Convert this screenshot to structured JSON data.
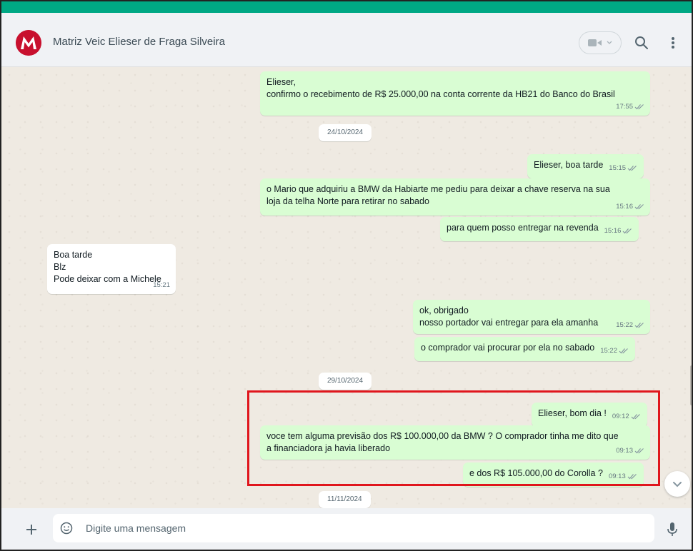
{
  "header": {
    "contact_name": "Matriz Veic Elieser de Fraga Silveira",
    "icons": {
      "avatar": "company-logo",
      "video": "video-call-icon",
      "search": "search-icon",
      "menu": "more-vertical-icon"
    }
  },
  "messages": [
    {
      "type": "out",
      "text": "Elieser,\nconfirmo o recebimento de R$ 25.000,00 na conta corrente da HB21 do Banco do Brasil",
      "time": "17:55"
    },
    {
      "type": "date",
      "text": "24/10/2024"
    },
    {
      "type": "out",
      "text": "Elieser, boa tarde",
      "time": "15:15"
    },
    {
      "type": "out",
      "text": "o Mario que adquiriu a BMW da Habiarte me pediu para deixar a chave reserva na sua\nloja da telha Norte para retirar no sabado",
      "time": "15:16"
    },
    {
      "type": "out",
      "text": "para quem posso entregar na revenda",
      "time": "15:16"
    },
    {
      "type": "in",
      "text": "Boa tarde\nBlz\nPode deixar com a Michele",
      "time": "15:21"
    },
    {
      "type": "out",
      "text": "ok, obrigado\nnosso portador vai entregar para ela amanha",
      "time": "15:22"
    },
    {
      "type": "out",
      "text": "o comprador vai procurar por ela no sabado",
      "time": "15:22"
    },
    {
      "type": "date",
      "text": "29/10/2024"
    },
    {
      "type": "out",
      "text": "Elieser, bom dia !",
      "time": "09:12"
    },
    {
      "type": "out",
      "text": "voce tem alguma previsão dos R$ 100.000,00 da BMW ? O comprador tinha me dito que\na financiadora ja havia liberado",
      "time": "09:13"
    },
    {
      "type": "out",
      "text": "e dos R$ 105.000,00 do Corolla ?",
      "time": "09:13"
    },
    {
      "type": "date",
      "text": "11/11/2024"
    }
  ],
  "composer": {
    "placeholder": "Digite uma mensagem",
    "icons": {
      "attach": "plus-icon",
      "emoji": "emoji-icon",
      "mic": "microphone-icon"
    }
  },
  "colors": {
    "accent": "#00a884",
    "outgoing_bubble": "#d9fdd3",
    "incoming_bubble": "#ffffff",
    "chat_background": "#efeae2",
    "highlight_box": "#e0161d",
    "read_ticks": "#8696a0"
  }
}
